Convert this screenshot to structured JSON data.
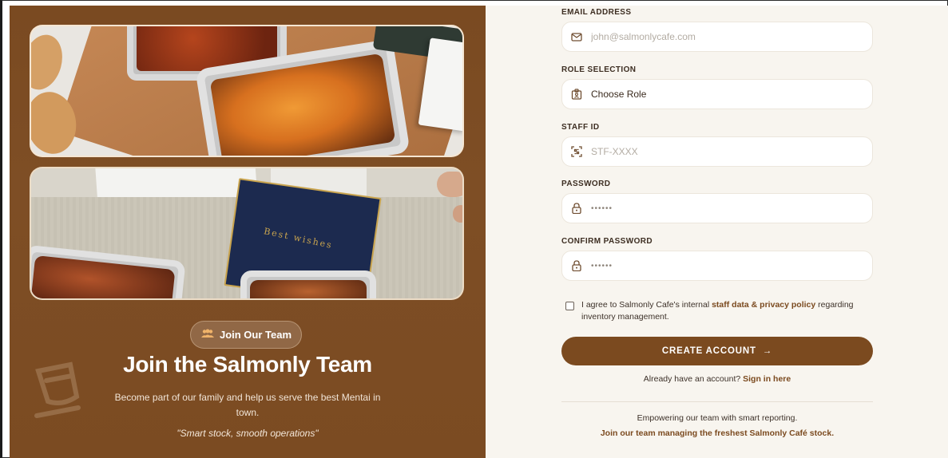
{
  "hero": {
    "badge_label": "Join Our Team",
    "badge_icon": "team-icon",
    "title": "Join the Salmonly Team",
    "subtitle": "Become part of our family and help us serve the best Mentai in town.",
    "quote": "\"Smart stock, smooth operations\""
  },
  "photos": {
    "card_text": "Best wishes"
  },
  "form": {
    "email": {
      "label": "EMAIL ADDRESS",
      "placeholder": "john@salmonlycafe.com",
      "icon": "mail-icon"
    },
    "role": {
      "label": "ROLE SELECTION",
      "value": "Choose Role",
      "icon": "id-badge-icon"
    },
    "staff_id": {
      "label": "STAFF ID",
      "placeholder": "STF-XXXX",
      "icon": "qr-scan-icon"
    },
    "password": {
      "label": "PASSWORD",
      "value": "••••••",
      "icon": "lock-icon"
    },
    "confirm_password": {
      "label": "CONFIRM PASSWORD",
      "value": "••••••",
      "icon": "lock-icon"
    },
    "agree": {
      "prefix": "I agree to Salmonly Cafe's internal ",
      "link": "staff data & privacy policy",
      "suffix": " regarding inventory management.",
      "checked": false
    },
    "submit_label": "CREATE ACCOUNT",
    "submit_arrow": "→",
    "signin_prefix": "Already have an account? ",
    "signin_link": "Sign in here"
  },
  "footer": {
    "line1": "Empowering our team with smart reporting.",
    "line2": "Join our team managing the freshest Salmonly Café stock."
  },
  "colors": {
    "brand_brown": "#7b4a1f",
    "panel_brown": "#7a4a21",
    "form_bg": "#f8f5ef"
  }
}
